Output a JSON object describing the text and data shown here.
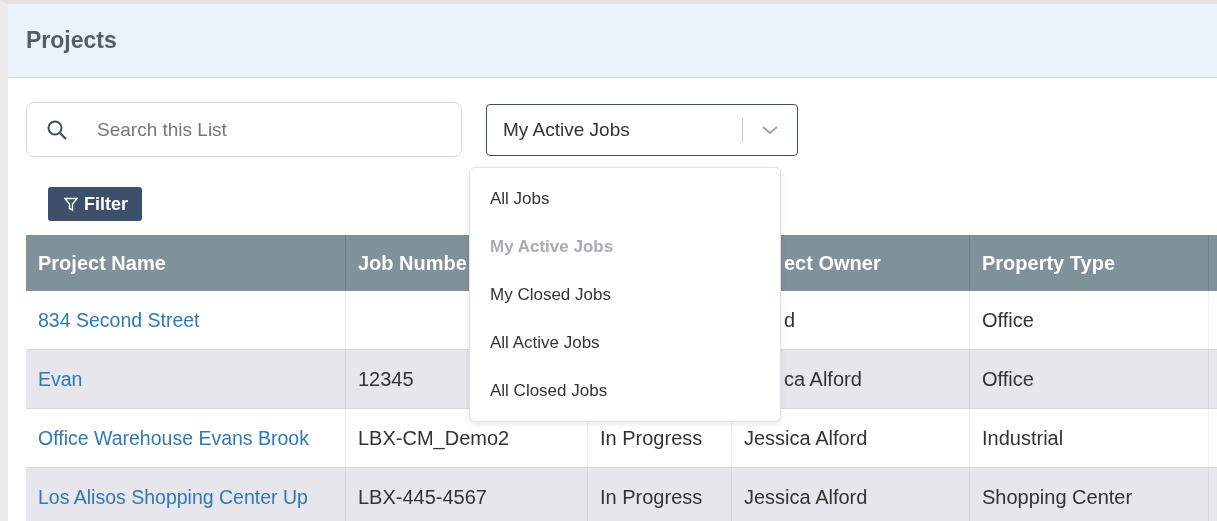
{
  "page": {
    "title": "Projects"
  },
  "search": {
    "placeholder": "Search this List"
  },
  "view_select": {
    "value": "My Active Jobs",
    "options": [
      {
        "label": "All Jobs",
        "selected": false
      },
      {
        "label": "My Active Jobs",
        "selected": true
      },
      {
        "label": "My Closed Jobs",
        "selected": false
      },
      {
        "label": "All Active Jobs",
        "selected": false
      },
      {
        "label": "All Closed Jobs",
        "selected": false
      }
    ]
  },
  "filter_button": {
    "label": "Filter"
  },
  "table": {
    "columns": [
      {
        "label": "Project Name"
      },
      {
        "label": "Job Numbe"
      },
      {},
      {
        "label": "ect Owner"
      },
      {
        "label": "Property Type"
      }
    ],
    "rows": [
      {
        "cells": [
          "834 Second Street",
          null,
          null,
          "d",
          "Office"
        ]
      },
      {
        "cells": [
          "Evan",
          "12345",
          null,
          "ca Alford",
          "Office"
        ]
      },
      {
        "cells": [
          "Office Warehouse Evans Brook",
          "LBX-CM_Demo2",
          "In Progress",
          "Jessica Alford",
          "Industrial"
        ]
      },
      {
        "cells": [
          "Los Alisos Shopping Center Up",
          "LBX-445-4567",
          "In Progress",
          "Jessica Alford",
          "Shopping Center"
        ]
      }
    ]
  }
}
